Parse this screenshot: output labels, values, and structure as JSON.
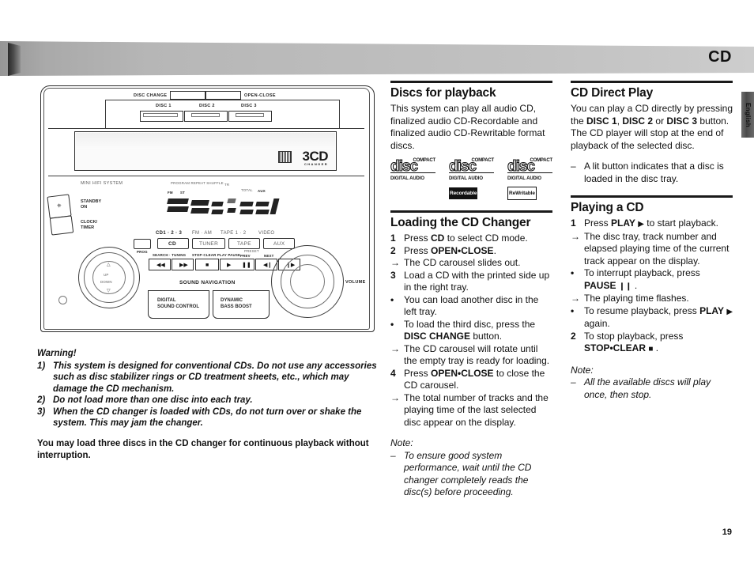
{
  "header": {
    "title": "CD",
    "lang_tab": "English"
  },
  "page_number": "19",
  "illustration": {
    "labels": {
      "disc_change": "DISC CHANGE",
      "open_close": "OPEN-CLOSE",
      "disc1": "DISC 1",
      "disc2": "DISC 2",
      "disc3": "DISC 3",
      "brand_logo": "3CD",
      "brand_logo_sub": "CHANGER",
      "mini_hifi": "MINI HIFI SYSTEM",
      "standby_on": "STANDBY\nON",
      "clock_timer": "CLOCK/\nTIMER",
      "source_cd": "CD1 · 2 · 3",
      "source_fm": "FM · AM",
      "source_tape": "TAPE 1 · 2",
      "source_video": "VIDEO",
      "prog": "PROG",
      "btn_cd": "CD",
      "btn_tuner": "TUNER",
      "btn_tape": "TAPE",
      "btn_aux": "AUX",
      "search_tuning": "SEARCH · TUNING",
      "stop_clear_play_pause": "STOP·CLEAR PLAY PAUSE",
      "preset": "PRESET",
      "prev": "PREV",
      "next": "NEXT",
      "sound_navigation": "SOUND NAVIGATION",
      "digital_sound_control": "DIGITAL\nSOUND CONTROL",
      "dynamic_bass_boost": "DYNAMIC\nBASS BOOST",
      "volume": "VOLUME"
    }
  },
  "warning": {
    "title": "Warning!",
    "items": [
      {
        "num": "1)",
        "text": "This system is designed for conventional CDs. Do not use any accessories such as disc stabilizer rings or CD treatment sheets, etc., which may damage the CD mechanism."
      },
      {
        "num": "2)",
        "text": "Do not load more than one disc into each tray."
      },
      {
        "num": "3)",
        "text": "When the CD changer is loaded with CDs, do not turn over or shake the system. This may jam the changer."
      }
    ],
    "footer": "You may load three discs in the CD changer for continuous playback without interruption."
  },
  "columns": {
    "middle": {
      "section1": {
        "heading": "Discs for playback",
        "body": "This system can play all audio CD, finalized audio CD-Recordable and finalized audio CD-Rewritable format discs.",
        "logos": [
          {
            "compact": "COMPACT",
            "word": "disc",
            "da": "DIGITAL AUDIO",
            "sub": "",
            "sub_style": "none"
          },
          {
            "compact": "COMPACT",
            "word": "disc",
            "da": "DIGITAL AUDIO",
            "sub": "Recordable",
            "sub_style": "inverted"
          },
          {
            "compact": "COMPACT",
            "word": "disc",
            "da": "DIGITAL AUDIO",
            "sub": "ReWritable",
            "sub_style": "outlined"
          }
        ]
      },
      "section2": {
        "heading": "Loading the CD Changer",
        "steps": [
          {
            "marker": "1",
            "kind": "num",
            "text": "Press <b>CD</b> to select CD mode."
          },
          {
            "marker": "2",
            "kind": "num",
            "text": "Press <b>OPEN•CLOSE</b>."
          },
          {
            "marker": "→",
            "kind": "arrow",
            "text": "The CD carousel slides out."
          },
          {
            "marker": "3",
            "kind": "num",
            "text": "Load a CD with the printed side up in the right tray."
          },
          {
            "marker": "•",
            "kind": "bullet",
            "text": "You can load another disc in the left tray."
          },
          {
            "marker": "•",
            "kind": "bullet",
            "text": "To load the third disc, press the <b>DISC CHANGE</b> button."
          },
          {
            "marker": "→",
            "kind": "arrow",
            "text": "The CD carousel will rotate until the empty tray is ready for loading."
          },
          {
            "marker": "4",
            "kind": "num",
            "text": "Press <b>OPEN•CLOSE</b> to close the CD carousel."
          },
          {
            "marker": "→",
            "kind": "arrow",
            "text": "The total number of tracks and the playing time of the last selected disc appear on the display."
          }
        ],
        "note_heading": "Note:",
        "note_marker": "–",
        "note_text": "To ensure good system performance, wait until the CD changer completely reads the disc(s) before proceeding."
      }
    },
    "right": {
      "section1": {
        "heading": "CD Direct Play",
        "body": "You can play a CD directly by pressing the <b>DISC 1</b>, <b>DISC 2</b> or <b>DISC 3</b> button. The CD player will stop at the end of playback of the selected disc.",
        "dash_marker": "–",
        "dash_text": "A lit button indicates that a disc is loaded in the disc tray."
      },
      "section2": {
        "heading": "Playing a CD",
        "steps": [
          {
            "marker": "1",
            "kind": "num",
            "text": "Press <b>PLAY</b> <span class=\"glyph\">▶</span> to start playback."
          },
          {
            "marker": "→",
            "kind": "arrow",
            "text": "The disc tray, track number and elapsed playing time of the current track appear on the display."
          },
          {
            "marker": "•",
            "kind": "bullet",
            "text": "To interrupt playback, press <b>PAUSE</b> <span class=\"glyph\">❙❙</span> ."
          },
          {
            "marker": "→",
            "kind": "arrow",
            "text": "The playing time flashes."
          },
          {
            "marker": "•",
            "kind": "bullet",
            "text": "To resume playback, press <b>PLAY</b> <span class=\"glyph\">▶</span> again."
          },
          {
            "marker": "2",
            "kind": "num",
            "text": "To stop playback, press <b>STOP•CLEAR</b> <span class=\"glyph\">■</span> ."
          }
        ],
        "note_heading": "Note:",
        "note_marker": "–",
        "note_text": "All the available discs will play once, then stop."
      }
    }
  }
}
